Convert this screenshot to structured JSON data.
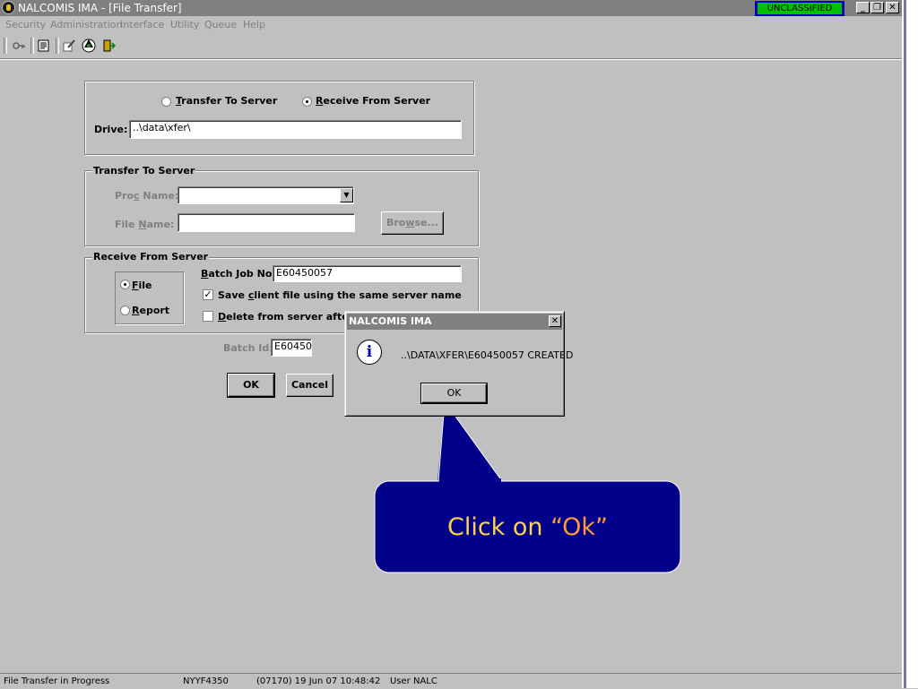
{
  "window": {
    "title": "NALCOMIS IMA - [File Transfer]",
    "classification": "UNCLASSIFIED",
    "buttons": {
      "minimize": "_",
      "restore": "❐",
      "close": "✕"
    }
  },
  "menu": [
    "Security",
    "Administration",
    "Interface",
    "Utility",
    "Queue",
    "Help"
  ],
  "toolbar": {
    "icons": [
      "key-icon",
      "document-icon",
      "edit-icon",
      "globe-icon",
      "exit-door-icon"
    ]
  },
  "mode": {
    "transfer_label_pre": "",
    "transfer_label_u": "T",
    "transfer_label_post": "ransfer To Server",
    "receive_label_pre": "",
    "receive_label_u": "R",
    "receive_label_post": "eceive From Server",
    "selected": "receive",
    "drive_label": "Drive:",
    "drive_value": "..\\data\\xfer\\"
  },
  "transfer_group": {
    "legend": "Transfer To Server",
    "proc_label_pre": "Pro",
    "proc_label_u": "c",
    "proc_label_post": " Name:",
    "proc_value": "",
    "file_label_pre": "File ",
    "file_label_u": "N",
    "file_label_post": "ame:",
    "file_value": "",
    "browse_pre": "Bro",
    "browse_u": "w",
    "browse_post": "se..."
  },
  "receive_group": {
    "legend": "Receive From Server",
    "type_file_pre": "",
    "type_file_u": "F",
    "type_file_post": "ile",
    "type_report_pre": "",
    "type_report_u": "R",
    "type_report_post": "eport",
    "selected_type": "file",
    "batch_label_pre": "",
    "batch_label_u": "B",
    "batch_label_post": "atch Job No:",
    "batch_value": "E60450057",
    "save_pre": "Save ",
    "save_u": "c",
    "save_post": "lient file using the same server name",
    "save_checked": true,
    "delete_pre": "",
    "delete_u": "D",
    "delete_post": "elete from server after fi",
    "delete_checked": false
  },
  "batch_id": {
    "label": "Batch Id:",
    "value": "E60450"
  },
  "actions": {
    "ok": "OK",
    "cancel": "Cancel"
  },
  "dialog": {
    "title": "NALCOMIS IMA",
    "message": "..\\DATA\\XFER\\E60450057 CREATED",
    "ok": "OK",
    "icon": "info-icon"
  },
  "callout": {
    "prefix": "Click on ",
    "quoted": "“Ok”"
  },
  "status": {
    "message": "File Transfer in Progress",
    "workstation": "NYYF4350",
    "datetime": "(07170) 19 Jun 07  10:48:42",
    "user": "User NALC"
  },
  "colors": {
    "callout_fill": "#00008b",
    "callout_text": "#ffd24a",
    "callout_quote": "#ff9a33",
    "classification_bg": "#00c000",
    "classification_border": "#0000c0"
  }
}
